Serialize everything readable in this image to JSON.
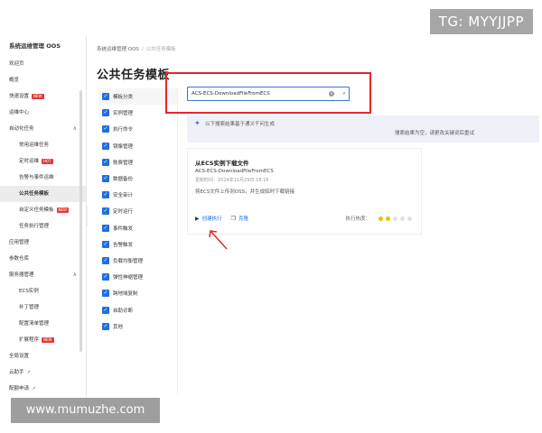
{
  "watermarks": {
    "top": "TG: MYYJJPP",
    "bottom": "www.mumuzhe.com"
  },
  "sidebar": {
    "title": "系统运维管理 OOS",
    "items": [
      {
        "label": "欢迎页",
        "level": 0
      },
      {
        "label": "概览",
        "level": 0
      },
      {
        "label": "快速设置",
        "level": 0,
        "badge": "NEW"
      },
      {
        "label": "运维中心",
        "level": 0
      },
      {
        "label": "自动化任务",
        "level": 0,
        "caret": "∧"
      },
      {
        "label": "常用运维任务",
        "level": 1
      },
      {
        "label": "定时运维",
        "level": 1,
        "badge": "HOT"
      },
      {
        "label": "告警与事件运维",
        "level": 1
      },
      {
        "label": "公共任务模板",
        "level": 1,
        "active": true
      },
      {
        "label": "自定义任务模板",
        "level": 1,
        "badge": "NEW"
      },
      {
        "label": "任务执行管理",
        "level": 1
      },
      {
        "label": "应用管理",
        "level": 0
      },
      {
        "label": "参数仓库",
        "level": 0
      },
      {
        "label": "服务器管理",
        "level": 0,
        "caret": "∧"
      },
      {
        "label": "ECS实例",
        "level": 1
      },
      {
        "label": "补丁管理",
        "level": 1
      },
      {
        "label": "配置清单管理",
        "level": 1
      },
      {
        "label": "扩展程序",
        "level": 1,
        "badge": "NEW"
      },
      {
        "label": "全局设置",
        "level": 0
      },
      {
        "label": "云助手",
        "level": 0,
        "ext": true
      },
      {
        "label": "配额申请",
        "level": 0,
        "ext": true
      }
    ]
  },
  "breadcrumb": {
    "root": "系统运维管理 OOS",
    "sep": "/",
    "current": "公共任务模板"
  },
  "page_title": "公共任务模板",
  "filters": [
    "模板分类",
    "实例管理",
    "执行命令",
    "镜像管理",
    "账费管理",
    "数据备份",
    "安全审计",
    "定时运行",
    "事件触发",
    "告警触发",
    "负载均衡管理",
    "弹性伸缩管理",
    "跨地域复制",
    "自助诊断",
    "其他"
  ],
  "search": {
    "value": "ACS-ECS-DownloadFileFromECS",
    "clear_icon": "×",
    "search_icon": "⌕"
  },
  "notice": {
    "line1": "以下搜索结果基于通义千问生成",
    "line2": "搜索结果为空，请更改关键词后重试"
  },
  "card": {
    "title": "从ECS实例下载文件",
    "name": "ACS-ECS-DownloadFileFromECS",
    "updated": "更新时间：2024年11月29日 18:16",
    "description": "将ECS文件上传到OSS，并生成临时下载链接",
    "action_run": "创建执行",
    "action_clone": "克隆",
    "heat_label": "执行热度：",
    "heat_level": 2,
    "heat_max": 5
  },
  "colors": {
    "accent": "#1f6fe0",
    "annotation": "#e3262e",
    "heat_on": "#e8c200"
  }
}
